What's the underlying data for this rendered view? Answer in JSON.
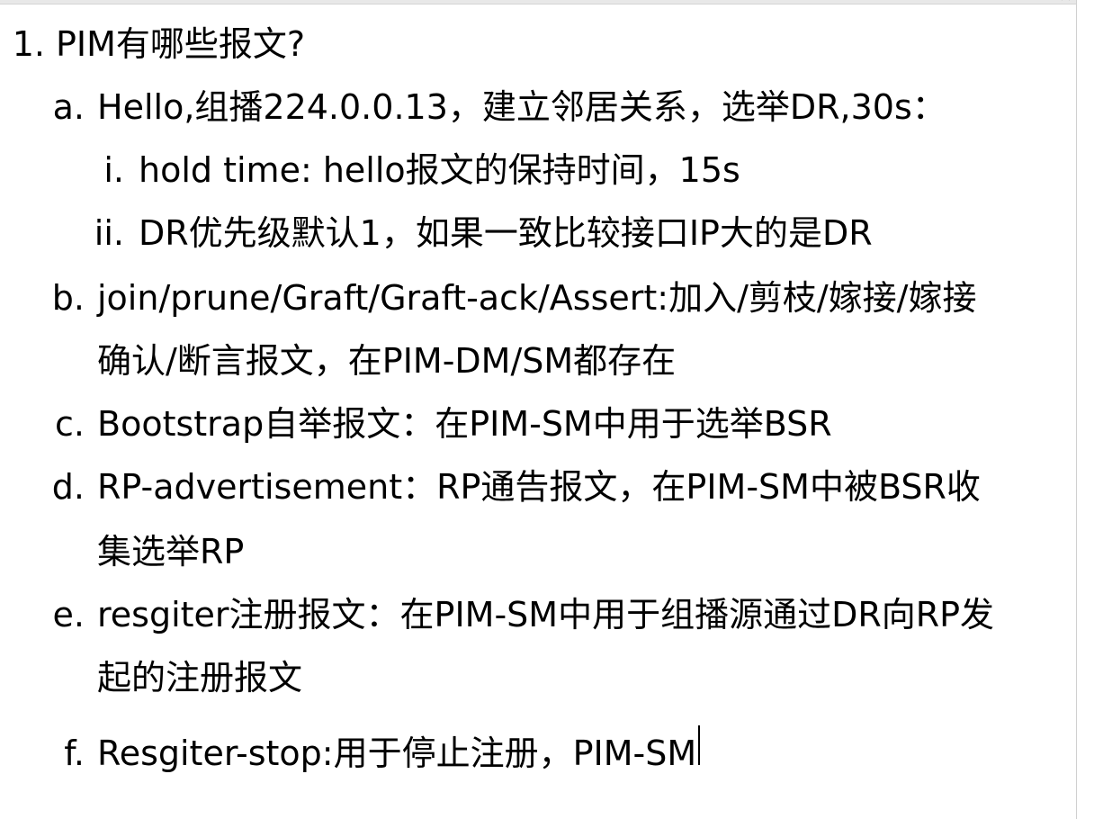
{
  "document": {
    "items": [
      {
        "marker": "1.",
        "text": "PIM有哪些报文?"
      },
      {
        "marker": "a.",
        "text": "Hello,组播224.0.0.13，建立邻居关系，选举DR,30s："
      },
      {
        "marker": "i.",
        "text": "hold time: hello报文的保持时间，15s"
      },
      {
        "marker": "ii.",
        "text": "DR优先级默认1，如果一致比较接口IP大的是DR"
      },
      {
        "marker": "b.",
        "text": "join/prune/Graft/Graft-ack/Assert:加入/剪枝/嫁接/嫁接"
      },
      {
        "marker": "",
        "text": "确认/断言报文，在PIM-DM/SM都存在"
      },
      {
        "marker": "c.",
        "text": "Bootstrap自举报文：在PIM-SM中用于选举BSR"
      },
      {
        "marker": "d.",
        "text": "RP-advertisement：RP通告报文，在PIM-SM中被BSR收"
      },
      {
        "marker": "",
        "text": "集选举RP"
      },
      {
        "marker": "e.",
        "text": "resgiter注册报文：在PIM-SM中用于组播源通过DR向RP发"
      },
      {
        "marker": "",
        "text": "起的注册报文"
      },
      {
        "marker": "f.",
        "text": "Resgiter-stop:用于停止注册，PIM-SM"
      }
    ]
  }
}
